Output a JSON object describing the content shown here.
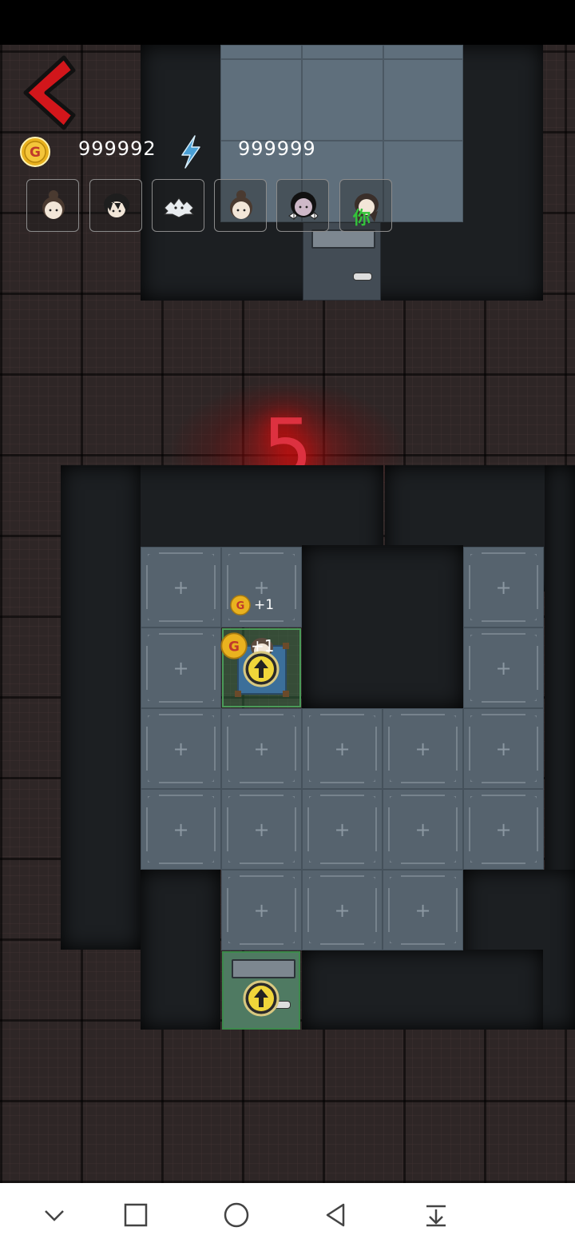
{
  "hud": {
    "coins": "999992",
    "energy": "999999",
    "coin_symbol": "G"
  },
  "room": {
    "number": "5"
  },
  "avatars": [
    {
      "name": "girl-bun",
      "tag": ""
    },
    {
      "name": "boy-dark-hair",
      "tag": ""
    },
    {
      "name": "ghost-spiky",
      "tag": ""
    },
    {
      "name": "girl-bun-2",
      "tag": ""
    },
    {
      "name": "girl-black-hair-bows",
      "tag": ""
    },
    {
      "name": "player-girl",
      "tag": "你"
    }
  ],
  "floating_rewards": [
    {
      "text": "+1",
      "symbol": "G"
    },
    {
      "text": "+1",
      "symbol": "G"
    }
  ],
  "tile_plus": "+",
  "colors": {
    "accent_red": "#dd3140",
    "coin_gold": "#e9b21f",
    "energy_blue": "#4aa0d6",
    "you_tag_green": "#33c43a"
  },
  "nav": {
    "buttons": [
      "chevron-down-icon",
      "square-icon",
      "circle-icon",
      "triangle-back-icon",
      "collapse-down-icon"
    ]
  }
}
